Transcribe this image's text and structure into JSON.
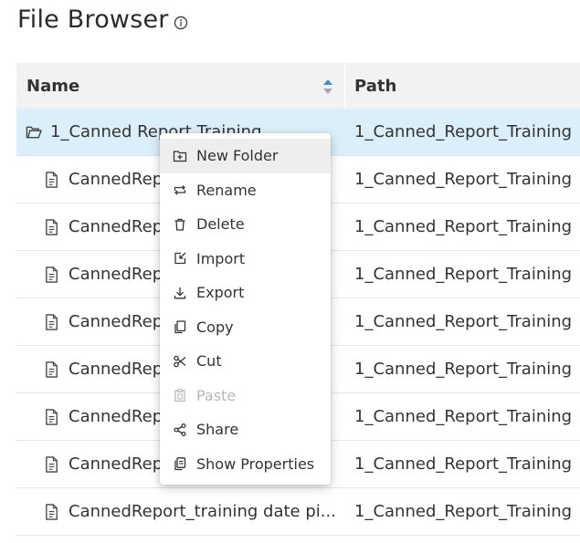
{
  "page": {
    "title": "File Browser",
    "info_icon": "info-icon"
  },
  "table": {
    "columns": [
      {
        "label": "Name"
      },
      {
        "label": "Path"
      }
    ],
    "rows": [
      {
        "name": "1_Canned Report Training",
        "path": "1_Canned_Report_Training",
        "type": "folder",
        "selected": true
      },
      {
        "name": "CannedRep",
        "path": "1_Canned_Report_Training",
        "type": "file"
      },
      {
        "name": "CannedRep",
        "path": "1_Canned_Report_Training",
        "type": "file"
      },
      {
        "name": "CannedRep",
        "path": "1_Canned_Report_Training",
        "type": "file"
      },
      {
        "name": "CannedRep",
        "path": "1_Canned_Report_Training",
        "type": "file"
      },
      {
        "name": "CannedRep",
        "path": "1_Canned_Report_Training",
        "type": "file"
      },
      {
        "name": "CannedRep",
        "path": "1_Canned_Report_Training",
        "type": "file"
      },
      {
        "name": "CannedRep",
        "path": "1_Canned_Report_Training",
        "type": "file"
      },
      {
        "name": "CannedReport_training date pi...",
        "path": "1_Canned_Report_Training",
        "type": "file"
      }
    ]
  },
  "context_menu": {
    "items": [
      {
        "label": "New Folder",
        "icon": "new-folder-icon",
        "state": "hover"
      },
      {
        "label": "Rename",
        "icon": "rename-icon"
      },
      {
        "label": "Delete",
        "icon": "trash-icon"
      },
      {
        "label": "Import",
        "icon": "import-icon"
      },
      {
        "label": "Export",
        "icon": "download-icon"
      },
      {
        "label": "Copy",
        "icon": "copy-icon"
      },
      {
        "label": "Cut",
        "icon": "scissors-icon"
      },
      {
        "label": "Paste",
        "icon": "paste-icon",
        "state": "disabled"
      },
      {
        "label": "Share",
        "icon": "share-icon"
      },
      {
        "label": "Show Properties",
        "icon": "properties-icon"
      }
    ]
  },
  "colors": {
    "selected_row": "#dbeffa",
    "header_bg": "#f2f2f2",
    "sort_accent": "#3d8fd8"
  }
}
